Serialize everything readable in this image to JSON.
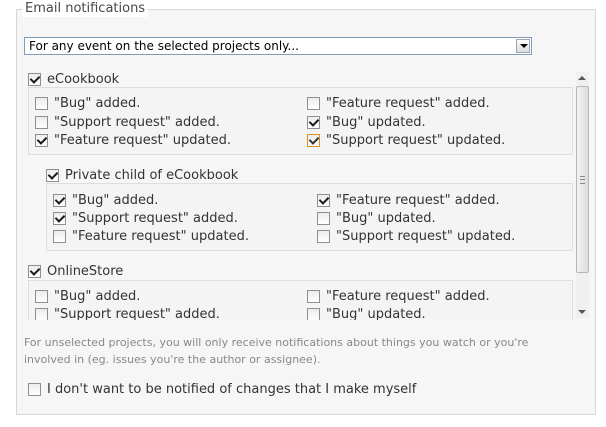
{
  "legend": "Email notifications",
  "mode_select": {
    "value": "For any event on the selected projects only..."
  },
  "projects": [
    {
      "name": "eCookbook",
      "checked": true,
      "options": [
        {
          "label": "\"Bug\" added.",
          "checked": false
        },
        {
          "label": "\"Feature request\" added.",
          "checked": false
        },
        {
          "label": "\"Support request\" added.",
          "checked": false
        },
        {
          "label": "\"Bug\" updated.",
          "checked": true
        },
        {
          "label": "\"Feature request\" updated.",
          "checked": true
        },
        {
          "label": "\"Support request\" updated.",
          "checked": true
        }
      ]
    },
    {
      "name": "Private child of eCookbook",
      "checked": true,
      "options": [
        {
          "label": "\"Bug\" added.",
          "checked": true
        },
        {
          "label": "\"Feature request\" added.",
          "checked": true
        },
        {
          "label": "\"Support request\" added.",
          "checked": true
        },
        {
          "label": "\"Bug\" updated.",
          "checked": false
        },
        {
          "label": "\"Feature request\" updated.",
          "checked": false
        },
        {
          "label": "\"Support request\" updated.",
          "checked": false
        }
      ]
    },
    {
      "name": "OnlineStore",
      "checked": true,
      "options": [
        {
          "label": "\"Bug\" added.",
          "checked": false
        },
        {
          "label": "\"Feature request\" added.",
          "checked": false
        },
        {
          "label": "\"Support request\" added.",
          "checked": false
        },
        {
          "label": "\"Bug\" updated.",
          "checked": false
        }
      ]
    }
  ],
  "note": "For unselected projects, you will only receive notifications about things you watch or you're involved in (eg. issues you're the author or assignee).",
  "no_self_notified": {
    "label": "I don't want to be notified of changes that I make myself",
    "checked": false
  }
}
